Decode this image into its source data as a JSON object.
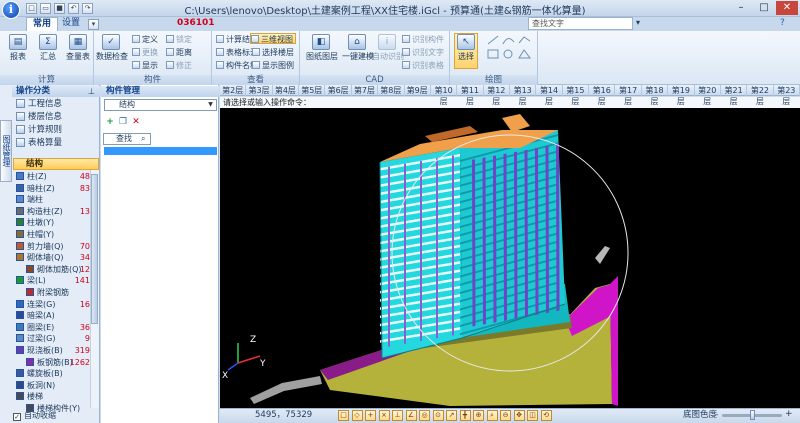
{
  "window": {
    "title": "C:\\Users\\lenovo\\Desktop\\土建案例工程\\XX住宅楼.iGcl - 预算通(土建&钢筋一体化算量)",
    "logo_letter": "i",
    "minimize": "–",
    "maximize": "□",
    "close": "✕"
  },
  "ribbon_tabs": [
    {
      "label": "常用"
    },
    {
      "label": "设置"
    }
  ],
  "serial_code": "036101",
  "search": {
    "placeholder": "查找文字"
  },
  "ribbon": {
    "groups": [
      {
        "label": "计算"
      },
      {
        "label": "构件"
      },
      {
        "label": "查看"
      },
      {
        "label": "CAD"
      },
      {
        "label": "绘图"
      }
    ],
    "report": "报表",
    "summary": "汇总",
    "quantity_table": "查量表",
    "data_check": "数据检查",
    "define": "定义",
    "lock": "锁定",
    "change": "更换",
    "distance": "距离",
    "show": "显示",
    "modify": "修正",
    "calc_result": "计算结果",
    "view_3d": "三维视图",
    "table_mark": "表格标注",
    "select_floor": "选择楼层",
    "component_name": "构件名称",
    "show_legend": "显示图例",
    "drawing_layer": "图纸图层",
    "one_click_build": "一键建模",
    "identify_component": "识别构件",
    "identify_text": "识别文字",
    "identify_table": "识别表格",
    "auto_identify": "自动识别",
    "select": "选择"
  },
  "left_panel": {
    "title": "操作分类",
    "side_tab": "图纸管理",
    "nav": [
      {
        "label": "工程信息"
      },
      {
        "label": "楼层信息"
      },
      {
        "label": "计算规则"
      },
      {
        "label": "表格算量"
      }
    ],
    "category": "结构",
    "tree": [
      {
        "label": "柱(Z)",
        "count": "48"
      },
      {
        "label": "暗柱(Z)",
        "count": "83"
      },
      {
        "label": "端柱",
        "count": ""
      },
      {
        "label": "构造柱(Z)",
        "count": "13"
      },
      {
        "label": "柱墩(Y)",
        "count": ""
      },
      {
        "label": "柱帽(Y)",
        "count": ""
      },
      {
        "label": "剪力墙(Q)",
        "count": "70"
      },
      {
        "label": "砌体墙(Q)",
        "count": "34"
      },
      {
        "label": "砌体加筋(Q)",
        "count": "12"
      },
      {
        "label": "梁(L)",
        "count": "141"
      },
      {
        "label": "附梁钢筋",
        "count": ""
      },
      {
        "label": "连梁(G)",
        "count": "16"
      },
      {
        "label": "暗梁(A)",
        "count": ""
      },
      {
        "label": "圈梁(E)",
        "count": "36"
      },
      {
        "label": "过梁(G)",
        "count": "9"
      },
      {
        "label": "现浇板(B)",
        "count": "319"
      },
      {
        "label": "板钢筋(B)",
        "count": "1262"
      },
      {
        "label": "螺旋板(B)",
        "count": ""
      },
      {
        "label": "板洞(N)",
        "count": ""
      },
      {
        "label": "楼梯",
        "count": ""
      },
      {
        "label": "楼梯构件(Y)",
        "count": ""
      }
    ],
    "auto_hide": "自动收缩"
  },
  "component_panel": {
    "title": "构件管理",
    "select_value": "结构",
    "search_label": "查找",
    "add": "+",
    "delete": "✕"
  },
  "floors": [
    "第2层",
    "第3层",
    "第4层",
    "第5层",
    "第6层",
    "第7层",
    "第8层",
    "第9层",
    "第10层",
    "第11层",
    "第12层",
    "第13层",
    "第14层",
    "第15层",
    "第16层",
    "第17层",
    "第18层",
    "第19层",
    "第20层",
    "第21层",
    "第22层",
    "第23层"
  ],
  "command_prompt": "请选择或输入操作命令：",
  "axes": {
    "x": "X",
    "y": "Y",
    "z": "Z"
  },
  "status": {
    "coords": "5495，75329",
    "color_label": "底图色度",
    "color_level": 0.5
  },
  "colors": {
    "viewport_bg": "#000000",
    "building_cyan": "#22e0e8",
    "roof_orange": "#f0a04a",
    "ground_olive": "#b5b23c",
    "slab_magenta": "#d015c8",
    "accent_red": "#d0021b"
  }
}
